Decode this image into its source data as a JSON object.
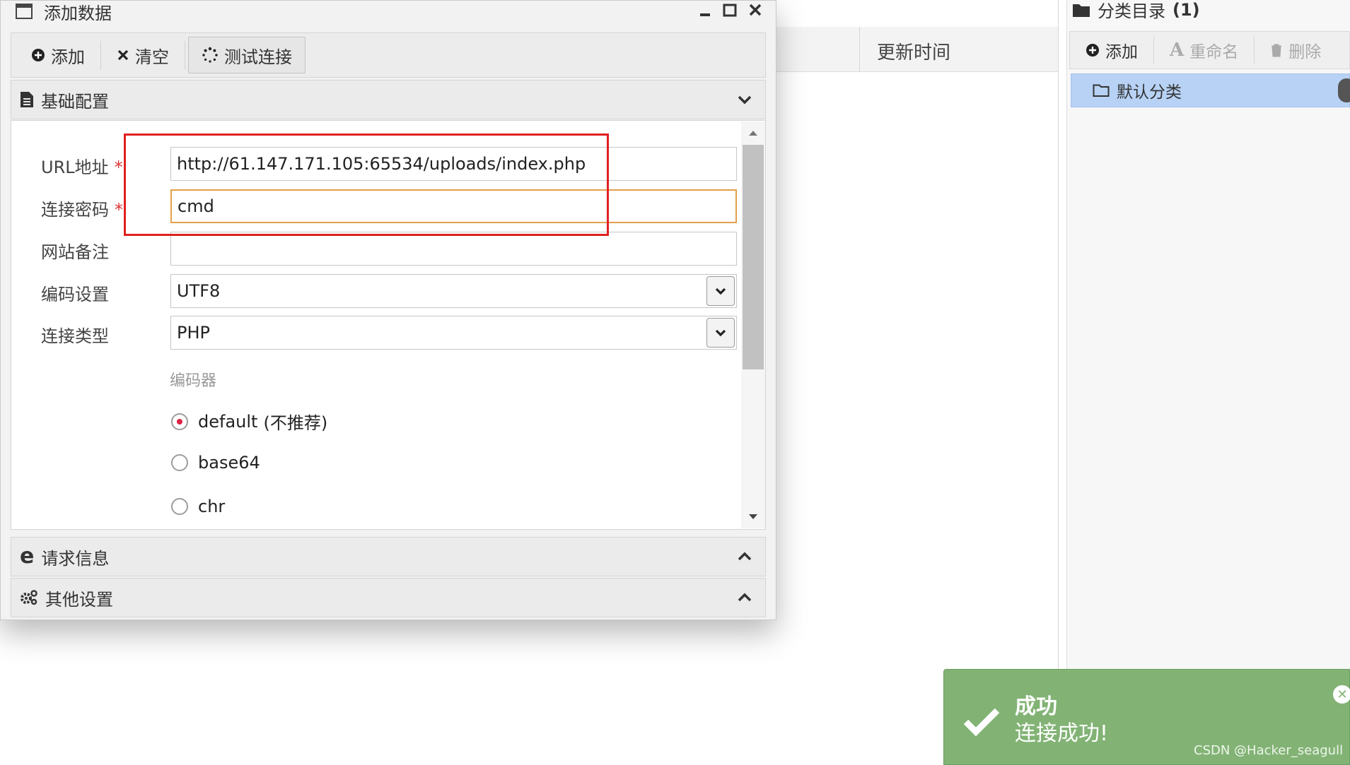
{
  "background": {
    "column_header": "更新时间"
  },
  "right_panel": {
    "title": "分类目录",
    "count": "(1)",
    "toolbar": {
      "add": "添加",
      "rename": "重命名",
      "delete": "删除"
    },
    "items": [
      "默认分类"
    ]
  },
  "dialog": {
    "title": "添加数据",
    "toolbar": {
      "add": "添加",
      "clear": "清空",
      "test": "测试连接"
    },
    "sections": {
      "basic": "基础配置",
      "request": "请求信息",
      "other": "其他设置"
    },
    "form": {
      "url_label": "URL地址",
      "url_value": "http://61.147.171.105:65534/uploads/index.php",
      "password_label": "连接密码",
      "password_value": "cmd",
      "note_label": "网站备注",
      "note_value": "",
      "encoding_label": "编码设置",
      "encoding_value": "UTF8",
      "type_label": "连接类型",
      "type_value": "PHP",
      "encoder_label": "编码器",
      "encoders": [
        {
          "label": "default",
          "hint": "(不推荐)",
          "selected": true
        },
        {
          "label": "base64",
          "selected": false
        },
        {
          "label": "chr",
          "selected": false
        }
      ],
      "required_mark": "*"
    }
  },
  "toast": {
    "title": "成功",
    "message": "连接成功!",
    "color": "#82b375"
  },
  "watermark": "CSDN @Hacker_seagull",
  "colors": {
    "highlight_box": "#e02020",
    "focus_border": "#e2a04b",
    "selection": "#b7d2f5"
  }
}
